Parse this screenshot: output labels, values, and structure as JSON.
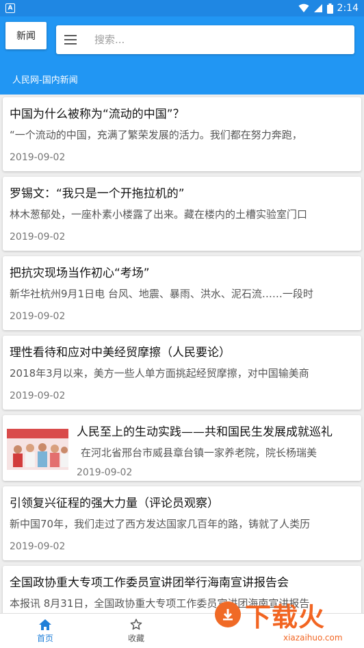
{
  "status_bar": {
    "time": "2:14",
    "notification_icon": "app-a-icon",
    "icons": [
      "wifi-icon",
      "signal-icon",
      "battery-icon"
    ]
  },
  "app_bar": {
    "tab_label": "新闻",
    "search_placeholder": "搜索...",
    "source_label": "人民网-国内新闻"
  },
  "articles": [
    {
      "title": "中国为什么被称为“流动的中国”？",
      "summary": "“一个流动的中国，充满了繁荣发展的活力。我们都在努力奔跑，",
      "date": "2019-09-02",
      "has_image": false
    },
    {
      "title": "罗锡文：“我只是一个开拖拉机的”",
      "summary": "林木葱郁处，一座朴素小楼露了出来。藏在楼内的土槽实验室门口",
      "date": "2019-09-02",
      "has_image": false
    },
    {
      "title": "把抗灾现场当作初心“考场”",
      "summary": "新华社杭州9月1日电 台风、地震、暴雨、洪水、泥石流……一段时",
      "date": "2019-09-02",
      "has_image": false
    },
    {
      "title": "理性看待和应对中美经贸摩擦（人民要论）",
      "summary": "2018年3月以来，美方一些人单方面挑起经贸摩擦，对中国输美商",
      "date": "2019-09-02",
      "has_image": false
    },
    {
      "title": "人民至上的生动实践——共和国民生发展成就巡礼",
      "summary": "在河北省邢台市威县章台镇一家养老院，院长杨瑞美",
      "date": "2019-09-02",
      "has_image": true
    },
    {
      "title": "引领复兴征程的强大力量（评论员观察）",
      "summary": "新中国70年，我们走过了西方发达国家几百年的路，铸就了人类历",
      "date": "2019-09-02",
      "has_image": false
    },
    {
      "title": "全国政协重大专项工作委员宣讲团举行海南宣讲报告会",
      "summary": "本报讯 8月31日，全国政协重大专项工作委员宣讲团海南宣讲报告",
      "date": "",
      "has_image": false
    }
  ],
  "bottom_nav": {
    "home_label": "首页",
    "favorites_label": "收藏"
  },
  "watermark": {
    "text": "下载火",
    "url": "xiazaihuo.com"
  },
  "colors": {
    "primary": "#2196f3",
    "status_bar": "#1f87e3",
    "nav_active": "#1f7fd8",
    "watermark": "#f26522"
  }
}
